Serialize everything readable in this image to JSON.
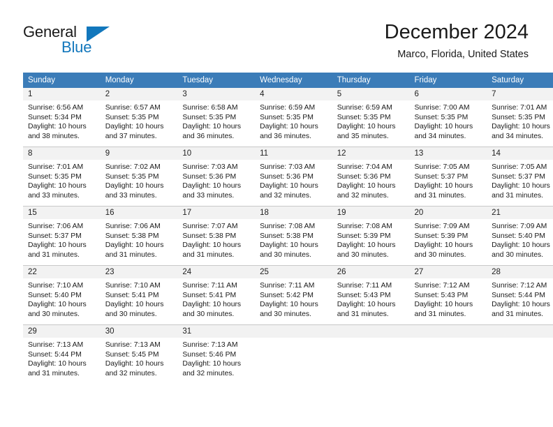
{
  "brand": {
    "name_part1": "General",
    "name_part2": "Blue"
  },
  "header": {
    "title": "December 2024",
    "location": "Marco, Florida, United States"
  },
  "colors": {
    "header_row_blue": "#3b7cb8",
    "brand_blue": "#1277bc",
    "daynum_band": "#f2f2f2",
    "row_divider": "#c8c8c8"
  },
  "weekday_headers": [
    "Sunday",
    "Monday",
    "Tuesday",
    "Wednesday",
    "Thursday",
    "Friday",
    "Saturday"
  ],
  "weeks": [
    [
      {
        "day": "1",
        "sunrise": "Sunrise: 6:56 AM",
        "sunset": "Sunset: 5:34 PM",
        "daylight1": "Daylight: 10 hours",
        "daylight2": "and 38 minutes."
      },
      {
        "day": "2",
        "sunrise": "Sunrise: 6:57 AM",
        "sunset": "Sunset: 5:35 PM",
        "daylight1": "Daylight: 10 hours",
        "daylight2": "and 37 minutes."
      },
      {
        "day": "3",
        "sunrise": "Sunrise: 6:58 AM",
        "sunset": "Sunset: 5:35 PM",
        "daylight1": "Daylight: 10 hours",
        "daylight2": "and 36 minutes."
      },
      {
        "day": "4",
        "sunrise": "Sunrise: 6:59 AM",
        "sunset": "Sunset: 5:35 PM",
        "daylight1": "Daylight: 10 hours",
        "daylight2": "and 36 minutes."
      },
      {
        "day": "5",
        "sunrise": "Sunrise: 6:59 AM",
        "sunset": "Sunset: 5:35 PM",
        "daylight1": "Daylight: 10 hours",
        "daylight2": "and 35 minutes."
      },
      {
        "day": "6",
        "sunrise": "Sunrise: 7:00 AM",
        "sunset": "Sunset: 5:35 PM",
        "daylight1": "Daylight: 10 hours",
        "daylight2": "and 34 minutes."
      },
      {
        "day": "7",
        "sunrise": "Sunrise: 7:01 AM",
        "sunset": "Sunset: 5:35 PM",
        "daylight1": "Daylight: 10 hours",
        "daylight2": "and 34 minutes."
      }
    ],
    [
      {
        "day": "8",
        "sunrise": "Sunrise: 7:01 AM",
        "sunset": "Sunset: 5:35 PM",
        "daylight1": "Daylight: 10 hours",
        "daylight2": "and 33 minutes."
      },
      {
        "day": "9",
        "sunrise": "Sunrise: 7:02 AM",
        "sunset": "Sunset: 5:35 PM",
        "daylight1": "Daylight: 10 hours",
        "daylight2": "and 33 minutes."
      },
      {
        "day": "10",
        "sunrise": "Sunrise: 7:03 AM",
        "sunset": "Sunset: 5:36 PM",
        "daylight1": "Daylight: 10 hours",
        "daylight2": "and 33 minutes."
      },
      {
        "day": "11",
        "sunrise": "Sunrise: 7:03 AM",
        "sunset": "Sunset: 5:36 PM",
        "daylight1": "Daylight: 10 hours",
        "daylight2": "and 32 minutes."
      },
      {
        "day": "12",
        "sunrise": "Sunrise: 7:04 AM",
        "sunset": "Sunset: 5:36 PM",
        "daylight1": "Daylight: 10 hours",
        "daylight2": "and 32 minutes."
      },
      {
        "day": "13",
        "sunrise": "Sunrise: 7:05 AM",
        "sunset": "Sunset: 5:37 PM",
        "daylight1": "Daylight: 10 hours",
        "daylight2": "and 31 minutes."
      },
      {
        "day": "14",
        "sunrise": "Sunrise: 7:05 AM",
        "sunset": "Sunset: 5:37 PM",
        "daylight1": "Daylight: 10 hours",
        "daylight2": "and 31 minutes."
      }
    ],
    [
      {
        "day": "15",
        "sunrise": "Sunrise: 7:06 AM",
        "sunset": "Sunset: 5:37 PM",
        "daylight1": "Daylight: 10 hours",
        "daylight2": "and 31 minutes."
      },
      {
        "day": "16",
        "sunrise": "Sunrise: 7:06 AM",
        "sunset": "Sunset: 5:38 PM",
        "daylight1": "Daylight: 10 hours",
        "daylight2": "and 31 minutes."
      },
      {
        "day": "17",
        "sunrise": "Sunrise: 7:07 AM",
        "sunset": "Sunset: 5:38 PM",
        "daylight1": "Daylight: 10 hours",
        "daylight2": "and 31 minutes."
      },
      {
        "day": "18",
        "sunrise": "Sunrise: 7:08 AM",
        "sunset": "Sunset: 5:38 PM",
        "daylight1": "Daylight: 10 hours",
        "daylight2": "and 30 minutes."
      },
      {
        "day": "19",
        "sunrise": "Sunrise: 7:08 AM",
        "sunset": "Sunset: 5:39 PM",
        "daylight1": "Daylight: 10 hours",
        "daylight2": "and 30 minutes."
      },
      {
        "day": "20",
        "sunrise": "Sunrise: 7:09 AM",
        "sunset": "Sunset: 5:39 PM",
        "daylight1": "Daylight: 10 hours",
        "daylight2": "and 30 minutes."
      },
      {
        "day": "21",
        "sunrise": "Sunrise: 7:09 AM",
        "sunset": "Sunset: 5:40 PM",
        "daylight1": "Daylight: 10 hours",
        "daylight2": "and 30 minutes."
      }
    ],
    [
      {
        "day": "22",
        "sunrise": "Sunrise: 7:10 AM",
        "sunset": "Sunset: 5:40 PM",
        "daylight1": "Daylight: 10 hours",
        "daylight2": "and 30 minutes."
      },
      {
        "day": "23",
        "sunrise": "Sunrise: 7:10 AM",
        "sunset": "Sunset: 5:41 PM",
        "daylight1": "Daylight: 10 hours",
        "daylight2": "and 30 minutes."
      },
      {
        "day": "24",
        "sunrise": "Sunrise: 7:11 AM",
        "sunset": "Sunset: 5:41 PM",
        "daylight1": "Daylight: 10 hours",
        "daylight2": "and 30 minutes."
      },
      {
        "day": "25",
        "sunrise": "Sunrise: 7:11 AM",
        "sunset": "Sunset: 5:42 PM",
        "daylight1": "Daylight: 10 hours",
        "daylight2": "and 30 minutes."
      },
      {
        "day": "26",
        "sunrise": "Sunrise: 7:11 AM",
        "sunset": "Sunset: 5:43 PM",
        "daylight1": "Daylight: 10 hours",
        "daylight2": "and 31 minutes."
      },
      {
        "day": "27",
        "sunrise": "Sunrise: 7:12 AM",
        "sunset": "Sunset: 5:43 PM",
        "daylight1": "Daylight: 10 hours",
        "daylight2": "and 31 minutes."
      },
      {
        "day": "28",
        "sunrise": "Sunrise: 7:12 AM",
        "sunset": "Sunset: 5:44 PM",
        "daylight1": "Daylight: 10 hours",
        "daylight2": "and 31 minutes."
      }
    ],
    [
      {
        "day": "29",
        "sunrise": "Sunrise: 7:13 AM",
        "sunset": "Sunset: 5:44 PM",
        "daylight1": "Daylight: 10 hours",
        "daylight2": "and 31 minutes."
      },
      {
        "day": "30",
        "sunrise": "Sunrise: 7:13 AM",
        "sunset": "Sunset: 5:45 PM",
        "daylight1": "Daylight: 10 hours",
        "daylight2": "and 32 minutes."
      },
      {
        "day": "31",
        "sunrise": "Sunrise: 7:13 AM",
        "sunset": "Sunset: 5:46 PM",
        "daylight1": "Daylight: 10 hours",
        "daylight2": "and 32 minutes."
      },
      {
        "day": "",
        "sunrise": "",
        "sunset": "",
        "daylight1": "",
        "daylight2": ""
      },
      {
        "day": "",
        "sunrise": "",
        "sunset": "",
        "daylight1": "",
        "daylight2": ""
      },
      {
        "day": "",
        "sunrise": "",
        "sunset": "",
        "daylight1": "",
        "daylight2": ""
      },
      {
        "day": "",
        "sunrise": "",
        "sunset": "",
        "daylight1": "",
        "daylight2": ""
      }
    ]
  ]
}
